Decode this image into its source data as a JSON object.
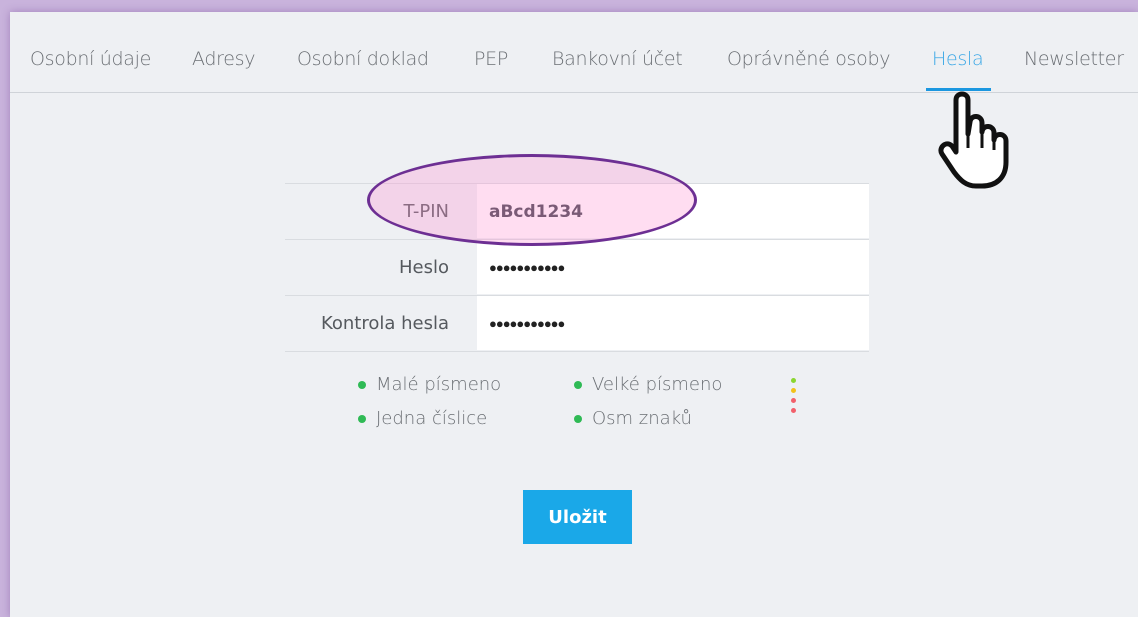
{
  "tabs": [
    {
      "label": "Osobní údaje"
    },
    {
      "label": "Adresy"
    },
    {
      "label": "Osobní doklad"
    },
    {
      "label": "PEP"
    },
    {
      "label": "Bankovní účet"
    },
    {
      "label": "Oprávněné osoby"
    },
    {
      "label": "Hesla",
      "active": true
    },
    {
      "label": "Newsletter"
    }
  ],
  "form": {
    "tpin_label": "T-PIN",
    "tpin_value": "aBcd1234",
    "password_label": "Heslo",
    "password_mask": "●●●●●●●●●●●",
    "confirm_label": "Kontrola hesla",
    "confirm_mask": "●●●●●●●●●●●"
  },
  "requirements": {
    "lowercase": "Malé písmeno",
    "uppercase": "Velké písmeno",
    "digit": "Jedna číslice",
    "eight_chars": "Osm znaků"
  },
  "colors": {
    "accent": "#1aa8e8",
    "requirement_ok": "#2fba55",
    "strength": [
      "#8bd630",
      "#f2c21a",
      "#f2606b",
      "#f2606b"
    ]
  },
  "save_label": "Uložit",
  "cursor_icon": "hand-pointer-icon"
}
